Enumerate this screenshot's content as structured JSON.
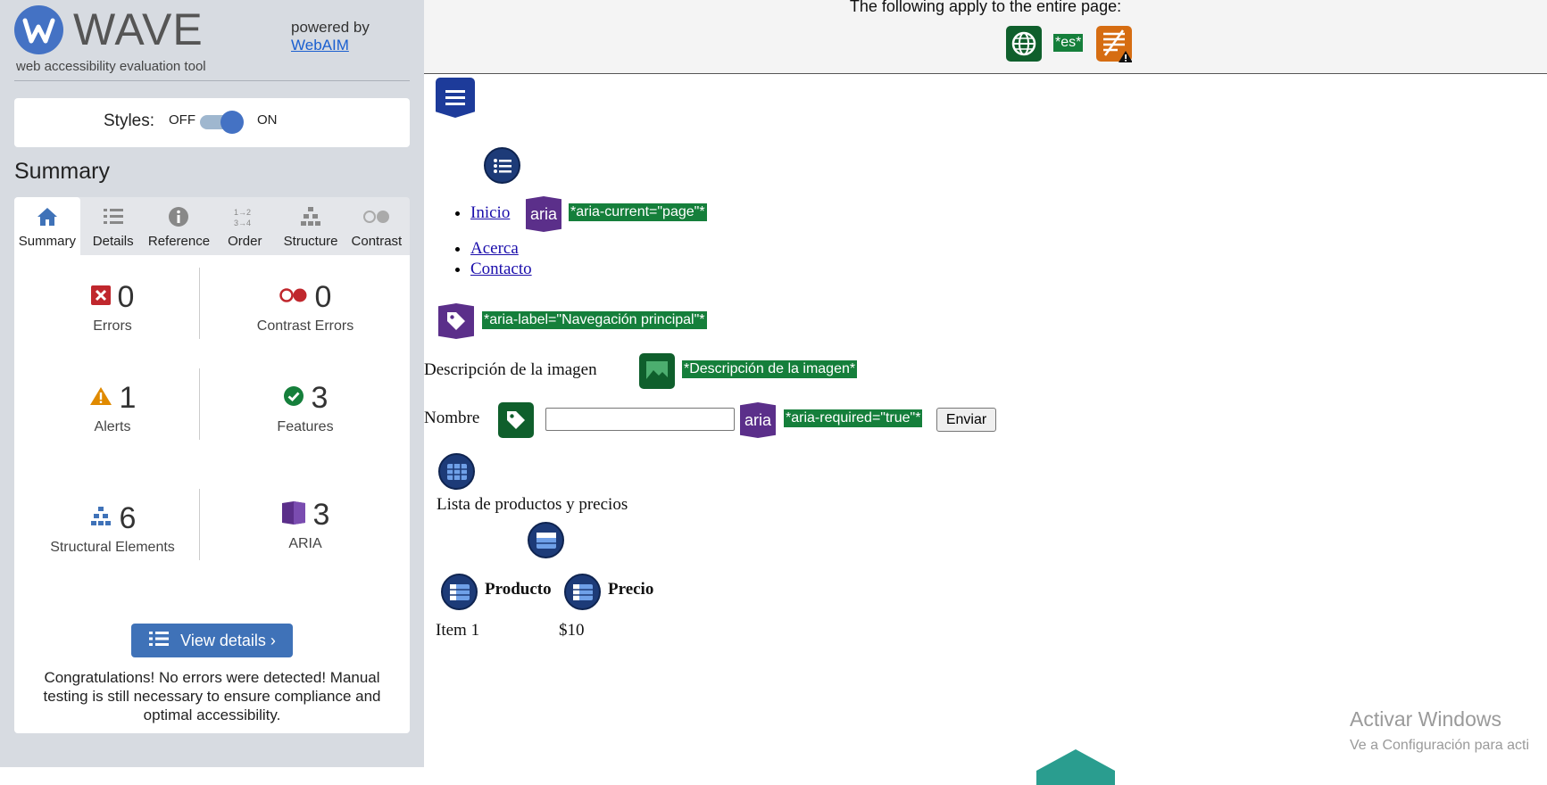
{
  "sidebar": {
    "logo_text": "WAVE",
    "logo_subtitle": "web accessibility evaluation tool",
    "powered_by": "powered by",
    "powered_link": "WebAIM",
    "styles_label": "Styles:",
    "styles_off": "OFF",
    "styles_on": "ON",
    "styles_enabled": true,
    "summary_title": "Summary",
    "tabs": [
      {
        "label": "Summary",
        "icon": "home-icon",
        "active": true
      },
      {
        "label": "Details",
        "icon": "list-icon",
        "active": false
      },
      {
        "label": "Reference",
        "icon": "info-icon",
        "active": false
      },
      {
        "label": "Order",
        "icon": "order-icon",
        "active": false
      },
      {
        "label": "Structure",
        "icon": "hierarchy-icon",
        "active": false
      },
      {
        "label": "Contrast",
        "icon": "contrast-icon",
        "active": false
      }
    ],
    "stats": {
      "errors": {
        "value": "0",
        "label": "Errors"
      },
      "contrast_errors": {
        "value": "0",
        "label": "Contrast Errors"
      },
      "alerts": {
        "value": "1",
        "label": "Alerts"
      },
      "features": {
        "value": "3",
        "label": "Features"
      },
      "structural": {
        "value": "6",
        "label": "Structural Elements"
      },
      "aria": {
        "value": "3",
        "label": "ARIA"
      }
    },
    "view_details": "View details ›",
    "congrats": "Congratulations! No errors were detected! Manual testing is still necessary to ensure compliance and optimal accessibility."
  },
  "main": {
    "banner_text": "The following apply to the entire page:",
    "lang_tag": "*es*",
    "nav_items": [
      "Inicio",
      "Acerca",
      "Contacto"
    ],
    "aria_icon_text": "aria",
    "aria_current": "*aria-current=\"page\"*",
    "aria_label": "*aria-label=\"Navegación principal\"*",
    "img_alt_text": "Descripción de la imagen",
    "img_alt_tag": "*Descripción de la imagen*",
    "form_label": "Nombre",
    "aria_required": "*aria-required=\"true\"*",
    "submit_label": "Enviar",
    "table_caption": "Lista de productos y precios",
    "th_product": "Producto",
    "th_price": "Precio",
    "row_item": "Item 1",
    "row_price": "$10",
    "watermark_title": "Activar Windows",
    "watermark_sub": "Ve a Configuración para acti"
  },
  "colors": {
    "wave_blue": "#4472c4",
    "feature_green": "#157f3b",
    "aria_purple": "#5b2f8a",
    "structure_navy": "#1d3b78",
    "alert_orange": "#e08a00",
    "error_red": "#c0272d"
  }
}
